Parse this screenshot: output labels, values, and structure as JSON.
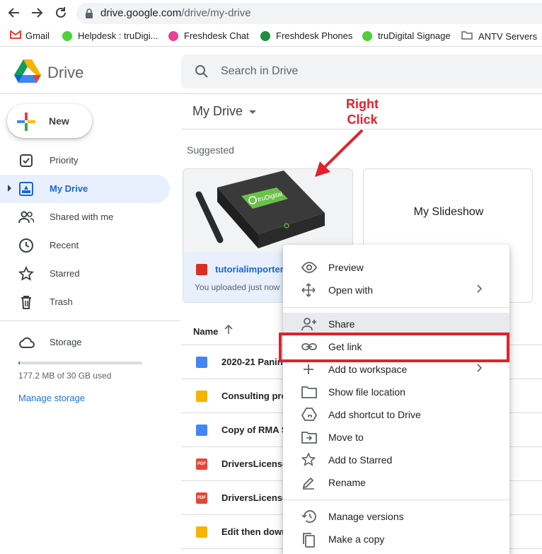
{
  "browser": {
    "url_host": "drive.google.com",
    "url_path": "/drive/my-drive",
    "bookmarks": [
      {
        "label": "Gmail",
        "color": "#ea4335"
      },
      {
        "label": "Helpdesk : truDigi...",
        "color": "#4cd137"
      },
      {
        "label": "Freshdesk Chat",
        "color": "#e84393"
      },
      {
        "label": "Freshdesk Phones",
        "color": "#1e8e3e"
      },
      {
        "label": "truDigital Signage",
        "color": "#4cd137"
      },
      {
        "label": "ANTV Servers",
        "color": "#5f6368"
      }
    ]
  },
  "header": {
    "app_name": "Drive",
    "search_placeholder": "Search in Drive"
  },
  "sidebar": {
    "new_label": "New",
    "items": [
      {
        "label": "Priority",
        "icon": "priority-icon"
      },
      {
        "label": "My Drive",
        "icon": "my-drive-icon",
        "active": true
      },
      {
        "label": "Shared with me",
        "icon": "shared-icon"
      },
      {
        "label": "Recent",
        "icon": "clock-icon"
      },
      {
        "label": "Starred",
        "icon": "star-icon"
      },
      {
        "label": "Trash",
        "icon": "trash-icon"
      }
    ],
    "storage_label": "Storage",
    "storage_used": "177.2 MB of 30 GB used",
    "storage_fraction": 0.006,
    "manage_storage": "Manage storage"
  },
  "main": {
    "title": "My Drive",
    "suggested_label": "Suggested",
    "cards": [
      {
        "name": "tutorialimporter.j",
        "meta": "You uploaded just now",
        "brand": "truDigital"
      },
      {
        "name": "My Slideshow"
      }
    ],
    "name_column": "Name",
    "files": [
      {
        "name": "2020-21 Panin",
        "type": "doc"
      },
      {
        "name": "Consulting prop",
        "type": "slide"
      },
      {
        "name": "Copy of RMA S",
        "type": "doc"
      },
      {
        "name": "DriversLicense",
        "type": "pdf"
      },
      {
        "name": "DriversLicense",
        "type": "pdf"
      },
      {
        "name": "Edit then down",
        "type": "slide"
      }
    ],
    "pdf_badge": "PDF"
  },
  "context_menu": {
    "items": [
      {
        "label": "Preview",
        "icon": "eye-icon"
      },
      {
        "label": "Open with",
        "icon": "open-with-icon",
        "submenu": true
      },
      {
        "label": "Share",
        "icon": "share-person-icon"
      },
      {
        "label": "Get link",
        "icon": "link-icon"
      },
      {
        "label": "Add to workspace",
        "icon": "plus-icon",
        "submenu": true
      },
      {
        "label": "Show file location",
        "icon": "folder-icon"
      },
      {
        "label": "Add shortcut to Drive",
        "icon": "shortcut-icon"
      },
      {
        "label": "Move to",
        "icon": "move-icon"
      },
      {
        "label": "Add to Starred",
        "icon": "star-icon"
      },
      {
        "label": "Rename",
        "icon": "pencil-icon"
      },
      {
        "label": "Manage versions",
        "icon": "history-icon"
      },
      {
        "label": "Make a copy",
        "icon": "copy-icon"
      }
    ]
  },
  "annotation": {
    "line1": "Right",
    "line2": "Click",
    "color": "#e5202a"
  }
}
